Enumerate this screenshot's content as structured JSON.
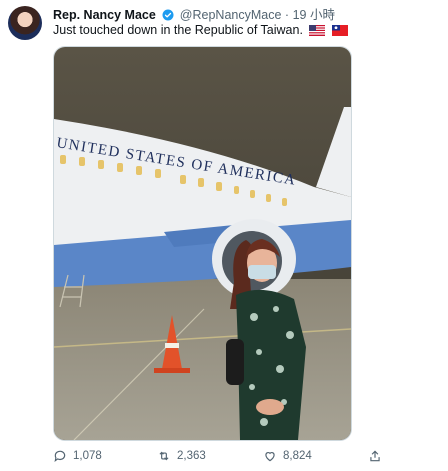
{
  "user": {
    "name": "Rep. Nancy Mace",
    "handle": "@RepNancyMace",
    "separator": "·",
    "time": "19 小時"
  },
  "tweet": {
    "text": "Just touched down in the Republic of Taiwan.",
    "flags": [
      "us-flag-icon",
      "taiwan-flag-icon"
    ]
  },
  "photo": {
    "plane_lettering": "UNITED STATES OF AMERICA"
  },
  "actions": {
    "replies": "1,078",
    "retweets": "2,363",
    "likes": "8,824"
  },
  "colors": {
    "verified_blue": "#1d9bf0",
    "muted_text": "#536471",
    "plane_blue": "#5a86c8",
    "night_sky": "#4a4538"
  },
  "icons": [
    "reply-icon",
    "retweet-icon",
    "like-icon",
    "share-icon",
    "verified-badge-icon"
  ]
}
